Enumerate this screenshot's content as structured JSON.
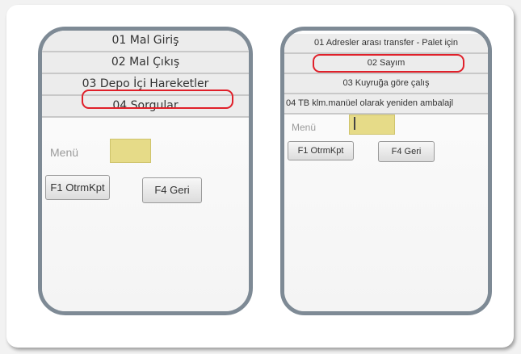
{
  "left_screen": {
    "menu_items": [
      {
        "label": "01 Mal Giriş"
      },
      {
        "label": "02 Mal Çıkış"
      },
      {
        "label": "03 Depo İçi Hareketler"
      },
      {
        "label": "04 Sorgular"
      }
    ],
    "highlighted_item": "03 Depo İçi Hareketler",
    "menu_label": "Menü",
    "menu_input_value": "",
    "buttons": {
      "f1": "F1 OtrmKpt",
      "f4": "F4 Geri"
    }
  },
  "right_screen": {
    "menu_items": [
      {
        "label": "01 Adresler arası transfer - Palet için"
      },
      {
        "label": "02 Sayım"
      },
      {
        "label": "03 Kuyruğa göre çalış"
      },
      {
        "label": "04 TB klm.manüel olarak yeniden ambalajl"
      }
    ],
    "highlighted_item": "02 Sayım",
    "menu_label": "Menü",
    "menu_input_value": "",
    "buttons": {
      "f1": "F1 OtrmKpt",
      "f4": "F4 Geri"
    }
  },
  "colors": {
    "highlight": "#e0202a",
    "input_fill": "#e6db88",
    "device_frame": "#7e8a95"
  }
}
